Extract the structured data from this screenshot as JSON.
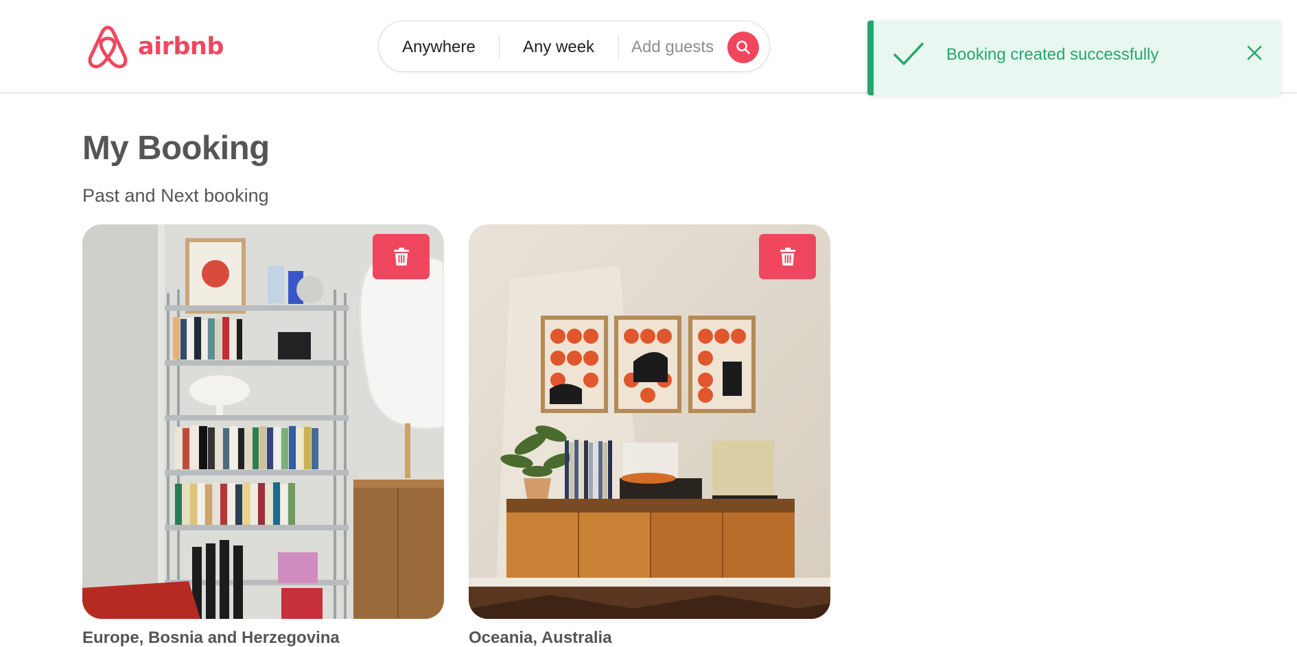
{
  "brand": {
    "name": "airbnb",
    "color": "#f0475f"
  },
  "search": {
    "location_label": "Anywhere",
    "date_label": "Any week",
    "guests_placeholder": "Add guests",
    "button_icon": "search-icon"
  },
  "toast": {
    "message": "Booking created successfully",
    "status": "success",
    "color": "#26a66e",
    "background": "#e8f7ef",
    "icons": [
      "check-icon",
      "close-icon"
    ]
  },
  "main": {
    "title": "My Booking",
    "subtitle": "Past and Next booking"
  },
  "bookings": [
    {
      "location": "Europe, Bosnia and Herzegovina",
      "image_icon": "listing-photo-bookshelf",
      "delete_icon": "trash-icon"
    },
    {
      "location": "Oceania, Australia",
      "image_icon": "listing-photo-sideboard",
      "delete_icon": "trash-icon"
    }
  ]
}
